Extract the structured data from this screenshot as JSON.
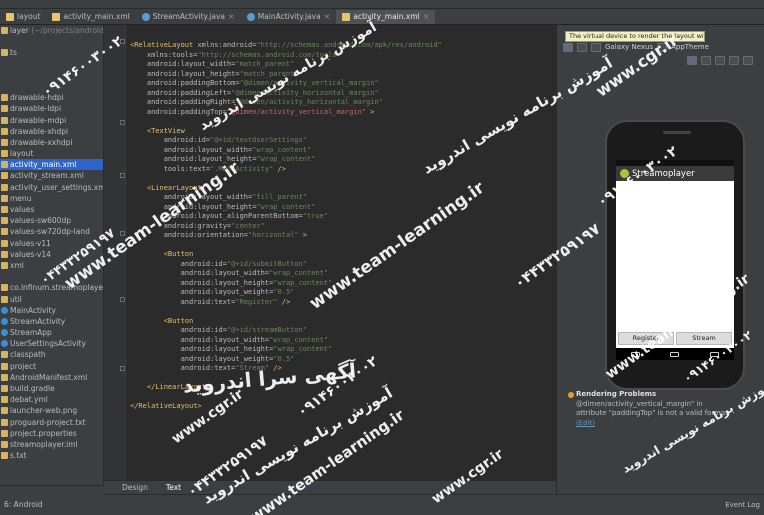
{
  "window": {
    "title_fragment": "streamoplayer"
  },
  "tabs": [
    {
      "label": "layout",
      "icon": "folder-icon"
    },
    {
      "label": "activity_main.xml",
      "icon": "xml-file-icon"
    },
    {
      "label": "StreamActivity.java",
      "icon": "java-class-icon"
    },
    {
      "label": "MainActivity.java",
      "icon": "java-class-icon"
    },
    {
      "label": "activity_main.xml",
      "icon": "xml-file-icon",
      "active": true
    }
  ],
  "project_tree": [
    {
      "text": "layer",
      "dim": " (~/projects/android/"
    },
    {
      "text": ""
    },
    {
      "text": "ts"
    },
    {
      "text": ""
    },
    {
      "text": ""
    },
    {
      "text": ""
    },
    {
      "text": "drawable-hdpi"
    },
    {
      "text": "drawable-ldpi"
    },
    {
      "text": "drawable-mdpi"
    },
    {
      "text": "drawable-xhdpi"
    },
    {
      "text": "drawable-xxhdpi"
    },
    {
      "text": "layout"
    },
    {
      "text": "activity_main.xml",
      "selected": true
    },
    {
      "text": "activity_stream.xml"
    },
    {
      "text": "activity_user_settings.xml"
    },
    {
      "text": "menu"
    },
    {
      "text": "values"
    },
    {
      "text": "values-sw600dp"
    },
    {
      "text": "values-sw720dp-land"
    },
    {
      "text": "values-v11"
    },
    {
      "text": "values-v14"
    },
    {
      "text": "xml"
    },
    {
      "text": ""
    },
    {
      "text": "co.infinum.streamoplayer"
    },
    {
      "text": "util"
    },
    {
      "text": "MainActivity",
      "cls": true
    },
    {
      "text": "StreamActivity",
      "cls": true
    },
    {
      "text": "StreamApp",
      "cls": true
    },
    {
      "text": "UserSettingsActivity",
      "cls": true
    },
    {
      "text": "classpath"
    },
    {
      "text": "project"
    },
    {
      "text": "AndroidManifest.xml"
    },
    {
      "text": "build.gradle"
    },
    {
      "text": "debat.yml"
    },
    {
      "text": "launcher-web.png"
    },
    {
      "text": "proguard-project.txt"
    },
    {
      "text": "project.properties"
    },
    {
      "text": "streamoplayer.iml"
    },
    {
      "text": "s.txt"
    }
  ],
  "left_bottom_tab": "6: Android",
  "code_lines": [
    [
      [
        "tg",
        "<RelativeLayout "
      ],
      [
        "at",
        "xmlns:android="
      ],
      [
        "vl",
        "\"http://schemas.android.com/apk/res/android\""
      ]
    ],
    [
      [
        "at",
        "    xmlns:tools="
      ],
      [
        "vl",
        "\"http://schemas.android.com/tools\""
      ]
    ],
    [
      [
        "at",
        "    android:layout_width="
      ],
      [
        "vl",
        "\"match_parent\""
      ]
    ],
    [
      [
        "at",
        "    android:layout_height="
      ],
      [
        "vl",
        "\"match_parent\""
      ]
    ],
    [
      [
        "at",
        "    android:paddingBottom="
      ],
      [
        "vl",
        "\"@dimen/activity_vertical_margin\""
      ]
    ],
    [
      [
        "at",
        "    android:paddingLeft="
      ],
      [
        "vl",
        "\"@dimen/activity_horizontal_margin\""
      ]
    ],
    [
      [
        "at",
        "    android:paddingRight="
      ],
      [
        "vl",
        "\"@dimen/activity_horizontal_margin\""
      ]
    ],
    [
      [
        "at",
        "    android:paddingTop="
      ],
      [
        "er",
        "\"@dimen/activity_vertical_margin\""
      ],
      [
        "tg",
        " >"
      ]
    ],
    [],
    [
      [
        "tg",
        "    <TextView"
      ]
    ],
    [
      [
        "at",
        "        android:id="
      ],
      [
        "vl",
        "\"@+id/textUserSettings\""
      ]
    ],
    [
      [
        "at",
        "        android:layout_width="
      ],
      [
        "vl",
        "\"wrap_content\""
      ]
    ],
    [
      [
        "at",
        "        android:layout_height="
      ],
      [
        "vl",
        "\"wrap_content\""
      ]
    ],
    [
      [
        "at",
        "        tools:text="
      ],
      [
        "vl",
        "\".MainActivity\""
      ],
      [
        "tg",
        " />"
      ]
    ],
    [],
    [
      [
        "tg",
        "    <LinearLayout"
      ]
    ],
    [
      [
        "at",
        "        android:layout_width="
      ],
      [
        "vl",
        "\"fill_parent\""
      ]
    ],
    [
      [
        "at",
        "        android:layout_height="
      ],
      [
        "vl",
        "\"wrap_content\""
      ]
    ],
    [
      [
        "at",
        "        android:layout_alignParentBottom="
      ],
      [
        "vl",
        "\"true\""
      ]
    ],
    [
      [
        "at",
        "        android:gravity="
      ],
      [
        "vl",
        "\"center\""
      ]
    ],
    [
      [
        "at",
        "        android:orientation="
      ],
      [
        "vl",
        "\"horizontal\""
      ],
      [
        "tg",
        " >"
      ]
    ],
    [],
    [
      [
        "tg",
        "        <Button"
      ]
    ],
    [
      [
        "at",
        "            android:id="
      ],
      [
        "vl",
        "\"@+id/submitButton\""
      ]
    ],
    [
      [
        "at",
        "            android:layout_width="
      ],
      [
        "vl",
        "\"wrap_content\""
      ]
    ],
    [
      [
        "at",
        "            android:layout_height="
      ],
      [
        "vl",
        "\"wrap_content\""
      ]
    ],
    [
      [
        "at",
        "            android:layout_weight="
      ],
      [
        "vl",
        "\"0.5\""
      ]
    ],
    [
      [
        "at",
        "            android:text="
      ],
      [
        "vl",
        "\"Register\""
      ],
      [
        "tg",
        " />"
      ]
    ],
    [],
    [
      [
        "tg",
        "        <Button"
      ]
    ],
    [
      [
        "at",
        "            android:id="
      ],
      [
        "vl",
        "\"@+id/streamButton\""
      ]
    ],
    [
      [
        "at",
        "            android:layout_width="
      ],
      [
        "vl",
        "\"wrap_content\""
      ]
    ],
    [
      [
        "at",
        "            android:layout_height="
      ],
      [
        "vl",
        "\"wrap_content\""
      ]
    ],
    [
      [
        "at",
        "            android:layout_weight="
      ],
      [
        "vl",
        "\"0.5\""
      ]
    ],
    [
      [
        "at",
        "            android:text="
      ],
      [
        "vl",
        "\"Stream\""
      ],
      [
        "tg",
        " />"
      ]
    ],
    [],
    [
      [
        "tg",
        "    </LinearLayout>"
      ]
    ],
    [],
    [
      [
        "tg",
        "</RelativeLayout>"
      ]
    ]
  ],
  "editor_bottom_tabs": [
    {
      "label": "Design"
    },
    {
      "label": "Text",
      "active": true
    }
  ],
  "preview": {
    "tooltip": "The virtual device to render the layout with",
    "device_label": "Galaxy Nexus",
    "theme_label": "AppTheme",
    "app_title": "Streamoplayer",
    "buttons": [
      "Register",
      "Stream"
    ]
  },
  "problems": {
    "title": "Rendering Problems",
    "lines": [
      "@dimen/activity_vertical_margin\" in",
      "attribute \"paddingTop\" is not a valid format."
    ],
    "link": "(Edit)"
  },
  "status": {
    "event_log": "Event Log"
  },
  "watermarks": [
    "www.team-learning.ir",
    "www.cgr.ir",
    "آموزش برنامه نویسی اندروید",
    "۰۹۱۴۶۰۰۳۰۰۲",
    "۰۴۴۳۳۲۵۹۱۹۷",
    "آگهی سرا اندروید"
  ]
}
